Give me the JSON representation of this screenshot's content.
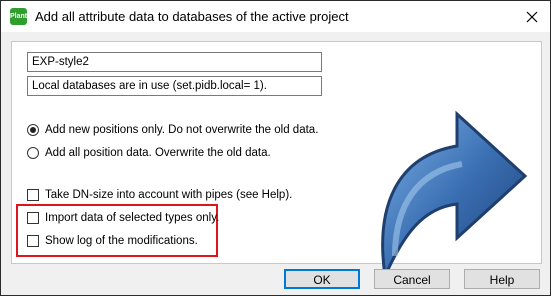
{
  "window": {
    "title": "Add all attribute data to databases of the active project",
    "app_icon_text": "Plant"
  },
  "fields": {
    "style_name": "EXP-style2",
    "database_info": "Local databases are in use (set.pidb.local= 1)."
  },
  "options": {
    "radio_new_positions": "Add new positions only. Do not overwrite the old data.",
    "radio_all_positions": "Add all position data. Overwrite the old data.",
    "radio_selected": "new_positions"
  },
  "checkboxes": {
    "dn_size": "Take DN-size into account with pipes (see Help).",
    "import_selected_types": "Import data of selected types only.",
    "show_log": "Show log of the modifications."
  },
  "buttons": {
    "ok": "OK",
    "cancel": "Cancel",
    "help": "Help"
  },
  "colors": {
    "highlight_border": "#e0141b",
    "arrow_blue": "#2f5d9e"
  }
}
